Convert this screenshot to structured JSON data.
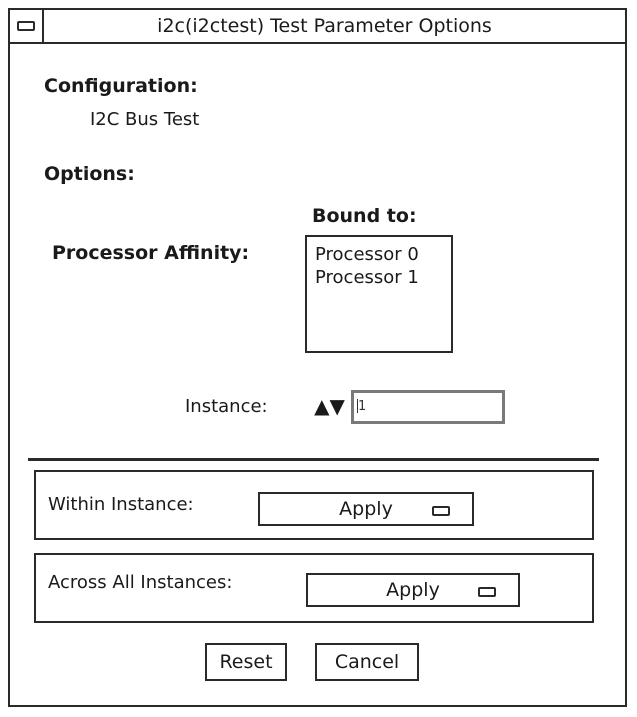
{
  "window": {
    "title": "i2c(i2ctest) Test Parameter Options"
  },
  "configuration": {
    "heading": "Configuration:",
    "value": "I2C Bus Test"
  },
  "options": {
    "heading": "Options:"
  },
  "affinity": {
    "label": "Processor Affinity:",
    "bound_to_label": "Bound to:",
    "processors": [
      "Processor 0",
      "Processor 1"
    ]
  },
  "instance": {
    "label": "Instance:",
    "spinner_glyph": "▲▼",
    "value": "1"
  },
  "within_instance": {
    "label": "Within Instance:",
    "selected": "Apply"
  },
  "across_instances": {
    "label": "Across All Instances:",
    "selected": "Apply"
  },
  "buttons": {
    "reset": "Reset",
    "cancel": "Cancel"
  }
}
